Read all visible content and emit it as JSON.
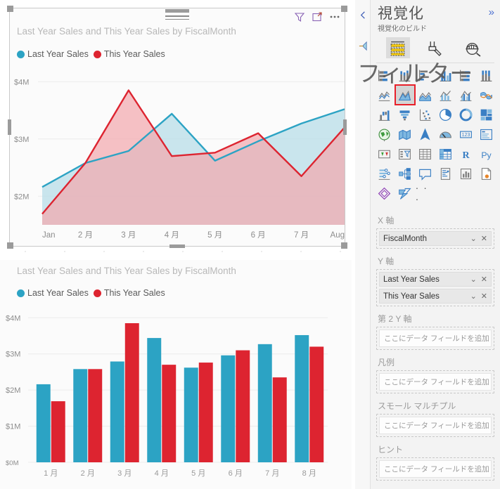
{
  "canvas": {
    "visual_toolbar": {
      "filter_icon": "filter-icon",
      "focus_icon": "focus-mode-icon",
      "more_icon": "more-options-icon"
    }
  },
  "area_visual": {
    "title": "Last Year Sales and This Year Sales by FiscalMonth",
    "legend": [
      {
        "label": "Last Year Sales",
        "color": "#2CA3C4"
      },
      {
        "label": "This Year Sales",
        "color": "#DD2430"
      }
    ]
  },
  "bar_visual": {
    "title": "Last Year Sales and This Year Sales by FiscalMonth",
    "legend": [
      {
        "label": "Last Year Sales",
        "color": "#2CA3C4"
      },
      {
        "label": "This Year Sales",
        "color": "#DD2430"
      }
    ]
  },
  "chart_data": [
    {
      "type": "area",
      "title": "Last Year Sales and This Year Sales by FiscalMonth",
      "xlabel": "FiscalMonth",
      "ylabel": "",
      "categories": [
        "Jan",
        "2 月",
        "3 月",
        "4 月",
        "5 月",
        "6 月",
        "7 月",
        "Aug"
      ],
      "ytick_labels": [
        "$2M",
        "$3M",
        "$4M"
      ],
      "ytick_values": [
        2000000,
        3000000,
        4000000
      ],
      "ylim": [
        1500000,
        4200000
      ],
      "grid": true,
      "legend_position": "top-left",
      "series": [
        {
          "name": "Last Year Sales",
          "color": "#2CA3C4",
          "fill": "#B5DCE8",
          "values": [
            2160000,
            2580000,
            2790000,
            3440000,
            2620000,
            2960000,
            3270000,
            3520000
          ]
        },
        {
          "name": "This Year Sales",
          "color": "#DD2430",
          "fill": "#F2A9AE",
          "values": [
            1690000,
            2580000,
            3850000,
            2700000,
            2760000,
            3100000,
            2350000,
            3200000
          ]
        }
      ]
    },
    {
      "type": "bar",
      "title": "Last Year Sales and This Year Sales by FiscalMonth",
      "xlabel": "FiscalMonth",
      "ylabel": "",
      "categories": [
        "1 月",
        "2 月",
        "3 月",
        "4 月",
        "5 月",
        "6 月",
        "7 月",
        "8 月"
      ],
      "ytick_labels": [
        "$0M",
        "$1M",
        "$2M",
        "$3M",
        "$4M"
      ],
      "ytick_values": [
        0,
        1000000,
        2000000,
        3000000,
        4000000
      ],
      "ylim": [
        0,
        4200000
      ],
      "grid": true,
      "legend_position": "top-left",
      "series": [
        {
          "name": "Last Year Sales",
          "color": "#2CA3C4",
          "values": [
            2160000,
            2580000,
            2790000,
            3440000,
            2620000,
            2960000,
            3270000,
            3520000
          ]
        },
        {
          "name": "This Year Sales",
          "color": "#DD2430",
          "values": [
            1690000,
            2580000,
            3850000,
            2700000,
            2760000,
            3100000,
            2350000,
            3200000
          ]
        }
      ]
    }
  ],
  "rail": {
    "collapse_icon": "chevron-left-icon",
    "filters_icon": "filters-pane-icon"
  },
  "viz_pane": {
    "title": "視覚化",
    "subtitle": "視覚化のビルド",
    "expand_label": "»",
    "tabs": [
      {
        "name": "build",
        "icon": "fields-build-icon",
        "active": true
      },
      {
        "name": "format",
        "icon": "paintbrush-format-icon",
        "active": false
      },
      {
        "name": "analytics",
        "icon": "magnifier-analytics-icon",
        "active": false
      }
    ],
    "visual_types": [
      "stacked-bar-chart-icon",
      "stacked-column-chart-icon",
      "clustered-bar-chart-icon",
      "clustered-column-chart-icon",
      "100-stacked-bar-chart-icon",
      "100-stacked-column-chart-icon",
      "line-chart-icon",
      "area-chart-icon",
      "stacked-area-chart-icon",
      "line-stacked-column-chart-icon",
      "line-clustered-column-chart-icon",
      "ribbon-chart-icon",
      "waterfall-chart-icon",
      "funnel-icon",
      "scatter-chart-icon",
      "pie-chart-icon",
      "donut-chart-icon",
      "treemap-icon",
      "map-icon",
      "filled-map-icon",
      "azure-map-icon",
      "gauge-icon",
      "card-icon",
      "multi-row-card-icon",
      "kpi-icon",
      "slicer-icon",
      "table-icon",
      "matrix-icon",
      "r-script-visual-icon",
      "python-visual-icon",
      "key-influencers-icon",
      "decomposition-tree-icon",
      "q-and-a-icon",
      "smart-narrative-icon",
      "metrics-icon",
      "paginated-report-icon",
      "power-apps-icon",
      "power-automate-icon",
      "more-visuals-icon"
    ],
    "highlighted_visual": "area-chart-icon",
    "field_wells": [
      {
        "label": "X 軸",
        "chips": [
          {
            "name": "FiscalMonth"
          }
        ],
        "placeholder": null
      },
      {
        "label": "Y 軸",
        "chips": [
          {
            "name": "Last Year Sales"
          },
          {
            "name": "This Year Sales"
          }
        ],
        "placeholder": null
      },
      {
        "label": "第 2 Y 軸",
        "chips": [],
        "placeholder": "ここにデータ フィールドを追加します"
      },
      {
        "label": "凡例",
        "chips": [],
        "placeholder": "ここにデータ フィールドを追加します"
      },
      {
        "label": "スモール マルチプル",
        "chips": [],
        "placeholder": "ここにデータ フィールドを追加します"
      },
      {
        "label": "ヒント",
        "chips": [],
        "placeholder": "ここにデータ フィールドを追加します"
      }
    ],
    "chip_dropdown_glyph": "⌄",
    "chip_remove_glyph": "✕"
  },
  "overlay": {
    "filter_text": "フィルター"
  }
}
